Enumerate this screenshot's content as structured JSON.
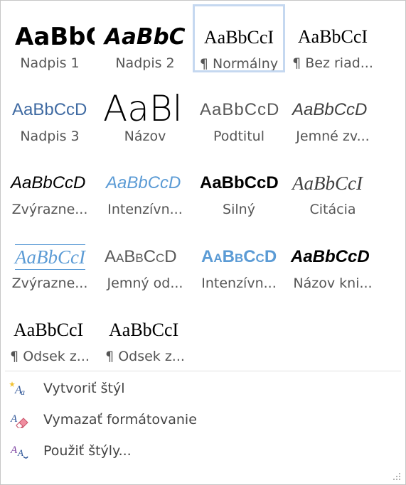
{
  "gallery": {
    "tiles": [
      {
        "sample": "AaBbC",
        "label": "Nadpis 1"
      },
      {
        "sample": "AaBbC",
        "label": "Nadpis 2"
      },
      {
        "sample": "AaBbCcI",
        "label": "¶ Normálny"
      },
      {
        "sample": "AaBbCcI",
        "label": "¶ Bez riad..."
      },
      {
        "sample": "AaBbCcD",
        "label": "Nadpis 3"
      },
      {
        "sample": "AaBl",
        "label": "Názov"
      },
      {
        "sample": "AaBbCcD",
        "label": "Podtitul"
      },
      {
        "sample": "AaBbCcD",
        "label": "Jemné zv..."
      },
      {
        "sample": "AaBbCcD",
        "label": "Zvýrazne..."
      },
      {
        "sample": "AaBbCcD",
        "label": "Intenzívn..."
      },
      {
        "sample": "AaBbCcD",
        "label": "Silný"
      },
      {
        "sample": "AaBbCcI",
        "label": "Citácia"
      },
      {
        "sample": "AaBbCcI",
        "label": "Zvýrazne..."
      },
      {
        "sample": "AaBbCcD",
        "label": "Jemný od..."
      },
      {
        "sample": "AaBbCcD",
        "label": "Intenzívn..."
      },
      {
        "sample": "AaBbCcD",
        "label": "Názov kni..."
      },
      {
        "sample": "AaBbCcI",
        "label": "¶ Odsek z..."
      },
      {
        "sample": "AaBbCcI",
        "label": "¶ Odsek z..."
      }
    ],
    "selected_index": 2
  },
  "menu": {
    "create_style": "Vytvoriť štýl",
    "clear_formatting": "Vymazať formátovanie",
    "apply_styles": "Použiť štýly..."
  },
  "icons": {
    "create_style": "new-style-icon",
    "clear_formatting": "eraser-icon",
    "apply_styles": "apply-styles-icon",
    "resize": "resize-grip-icon"
  },
  "colors": {
    "accent_blue": "#5b9bd5",
    "heading_blue": "#3f6aa2",
    "selected_border": "#c5d8f0"
  }
}
